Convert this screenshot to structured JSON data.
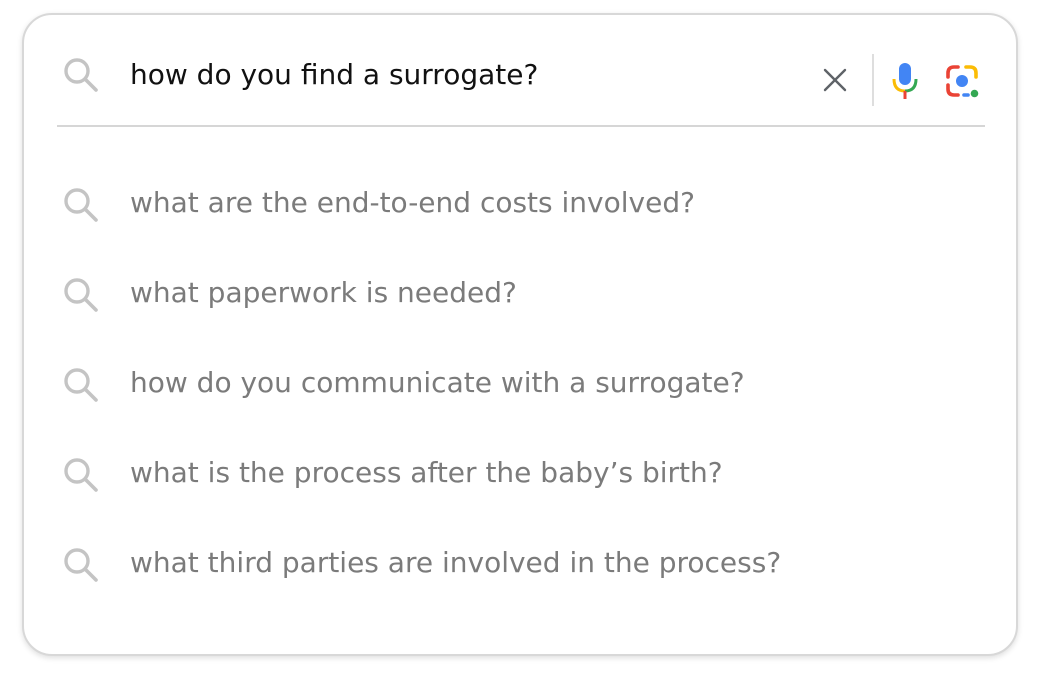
{
  "search": {
    "query": "how do you find a surrogate?",
    "icons": {
      "search": "search-icon",
      "clear": "close-icon",
      "voice": "microphone-icon",
      "lens": "google-lens-icon"
    }
  },
  "suggestions": [
    {
      "text": "what are the end-to-end costs involved?",
      "icon": "search-icon"
    },
    {
      "text": "what paperwork is needed?",
      "icon": "search-icon"
    },
    {
      "text": "how do you communicate with a surrogate?",
      "icon": "search-icon"
    },
    {
      "text": "what is the process after the baby’s birth?",
      "icon": "search-icon"
    },
    {
      "text": "what third parties are involved in the process?",
      "icon": "search-icon"
    }
  ],
  "colors": {
    "query_text": "#111111",
    "suggestion_text": "#7b7b7b",
    "icon_gray": "#c4c4c4",
    "google_blue": "#4285F4",
    "google_red": "#EA4335",
    "google_yellow": "#FBBC05",
    "google_green": "#34A853"
  }
}
